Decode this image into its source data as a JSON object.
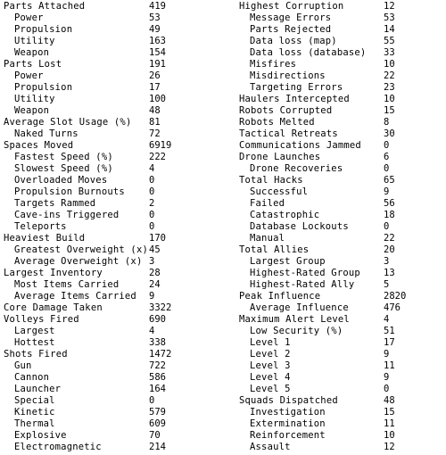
{
  "left": [
    {
      "label": "Parts Attached",
      "value": "419",
      "sub": false
    },
    {
      "label": "Power",
      "value": "53",
      "sub": true
    },
    {
      "label": "Propulsion",
      "value": "49",
      "sub": true
    },
    {
      "label": "Utility",
      "value": "163",
      "sub": true
    },
    {
      "label": "Weapon",
      "value": "154",
      "sub": true
    },
    {
      "label": "Parts Lost",
      "value": "191",
      "sub": false
    },
    {
      "label": "Power",
      "value": "26",
      "sub": true
    },
    {
      "label": "Propulsion",
      "value": "17",
      "sub": true
    },
    {
      "label": "Utility",
      "value": "100",
      "sub": true
    },
    {
      "label": "Weapon",
      "value": "48",
      "sub": true
    },
    {
      "label": "Average Slot Usage (%)",
      "value": "81",
      "sub": false
    },
    {
      "label": "Naked Turns",
      "value": "72",
      "sub": true
    },
    {
      "label": "Spaces Moved",
      "value": "6919",
      "sub": false
    },
    {
      "label": "Fastest Speed (%)",
      "value": "222",
      "sub": true
    },
    {
      "label": "Slowest Speed (%)",
      "value": "4",
      "sub": true
    },
    {
      "label": "Overloaded Moves",
      "value": "0",
      "sub": true
    },
    {
      "label": "Propulsion Burnouts",
      "value": "0",
      "sub": true
    },
    {
      "label": "Targets Rammed",
      "value": "2",
      "sub": true
    },
    {
      "label": "Cave-ins Triggered",
      "value": "0",
      "sub": true
    },
    {
      "label": "Teleports",
      "value": "0",
      "sub": true
    },
    {
      "label": "Heaviest Build",
      "value": "170",
      "sub": false
    },
    {
      "label": "Greatest Overweight (x)",
      "value": "45",
      "sub": true
    },
    {
      "label": "Average Overweight (x)",
      "value": "3",
      "sub": true
    },
    {
      "label": "Largest Inventory",
      "value": "28",
      "sub": false
    },
    {
      "label": "Most Items Carried",
      "value": "24",
      "sub": true
    },
    {
      "label": "Average Items Carried",
      "value": "9",
      "sub": true
    },
    {
      "label": "Core Damage Taken",
      "value": "3322",
      "sub": false
    },
    {
      "label": "Volleys Fired",
      "value": "690",
      "sub": false
    },
    {
      "label": "Largest",
      "value": "4",
      "sub": true
    },
    {
      "label": "Hottest",
      "value": "338",
      "sub": true
    },
    {
      "label": "Shots Fired",
      "value": "1472",
      "sub": false
    },
    {
      "label": "Gun",
      "value": "722",
      "sub": true
    },
    {
      "label": "Cannon",
      "value": "586",
      "sub": true
    },
    {
      "label": "Launcher",
      "value": "164",
      "sub": true
    },
    {
      "label": "Special",
      "value": "0",
      "sub": true
    },
    {
      "label": "Kinetic",
      "value": "579",
      "sub": true
    },
    {
      "label": "Thermal",
      "value": "609",
      "sub": true
    },
    {
      "label": "Explosive",
      "value": "70",
      "sub": true
    },
    {
      "label": "Electromagnetic",
      "value": "214",
      "sub": true
    }
  ],
  "right": [
    {
      "label": "Highest Corruption",
      "value": "12",
      "sub": false
    },
    {
      "label": "Message Errors",
      "value": "53",
      "sub": true
    },
    {
      "label": "Parts Rejected",
      "value": "14",
      "sub": true
    },
    {
      "label": "Data loss (map)",
      "value": "55",
      "sub": true
    },
    {
      "label": "Data loss (database)",
      "value": "33",
      "sub": true
    },
    {
      "label": "Misfires",
      "value": "10",
      "sub": true
    },
    {
      "label": "Misdirections",
      "value": "22",
      "sub": true
    },
    {
      "label": "Targeting Errors",
      "value": "23",
      "sub": true
    },
    {
      "label": "Haulers Intercepted",
      "value": "10",
      "sub": false
    },
    {
      "label": "Robots Corrupted",
      "value": "15",
      "sub": false
    },
    {
      "label": "Robots Melted",
      "value": "8",
      "sub": false
    },
    {
      "label": "Tactical Retreats",
      "value": "30",
      "sub": false
    },
    {
      "label": "Communications Jammed",
      "value": "0",
      "sub": false
    },
    {
      "label": "Drone Launches",
      "value": "6",
      "sub": false
    },
    {
      "label": "Drone Recoveries",
      "value": "0",
      "sub": true
    },
    {
      "label": "Total Hacks",
      "value": "65",
      "sub": false
    },
    {
      "label": "Successful",
      "value": "9",
      "sub": true
    },
    {
      "label": "Failed",
      "value": "56",
      "sub": true
    },
    {
      "label": "Catastrophic",
      "value": "18",
      "sub": true
    },
    {
      "label": "Database Lockouts",
      "value": "0",
      "sub": true
    },
    {
      "label": "Manual",
      "value": "22",
      "sub": true
    },
    {
      "label": "Total Allies",
      "value": "20",
      "sub": false
    },
    {
      "label": "Largest Group",
      "value": "3",
      "sub": true
    },
    {
      "label": "Highest-Rated Group",
      "value": "13",
      "sub": true
    },
    {
      "label": "Highest-Rated Ally",
      "value": "5",
      "sub": true
    },
    {
      "label": "Peak Influence",
      "value": "2820",
      "sub": false
    },
    {
      "label": "Average Influence",
      "value": "476",
      "sub": true
    },
    {
      "label": "Maximum Alert Level",
      "value": "4",
      "sub": false
    },
    {
      "label": "Low Security (%)",
      "value": "51",
      "sub": true
    },
    {
      "label": "Level 1",
      "value": "17",
      "sub": true
    },
    {
      "label": "Level 2",
      "value": "9",
      "sub": true
    },
    {
      "label": "Level 3",
      "value": "11",
      "sub": true
    },
    {
      "label": "Level 4",
      "value": "9",
      "sub": true
    },
    {
      "label": "Level 5",
      "value": "0",
      "sub": true
    },
    {
      "label": "Squads Dispatched",
      "value": "48",
      "sub": false
    },
    {
      "label": "Investigation",
      "value": "15",
      "sub": true
    },
    {
      "label": "Extermination",
      "value": "11",
      "sub": true
    },
    {
      "label": "Reinforcement",
      "value": "10",
      "sub": true
    },
    {
      "label": "Assault",
      "value": "12",
      "sub": true
    }
  ]
}
